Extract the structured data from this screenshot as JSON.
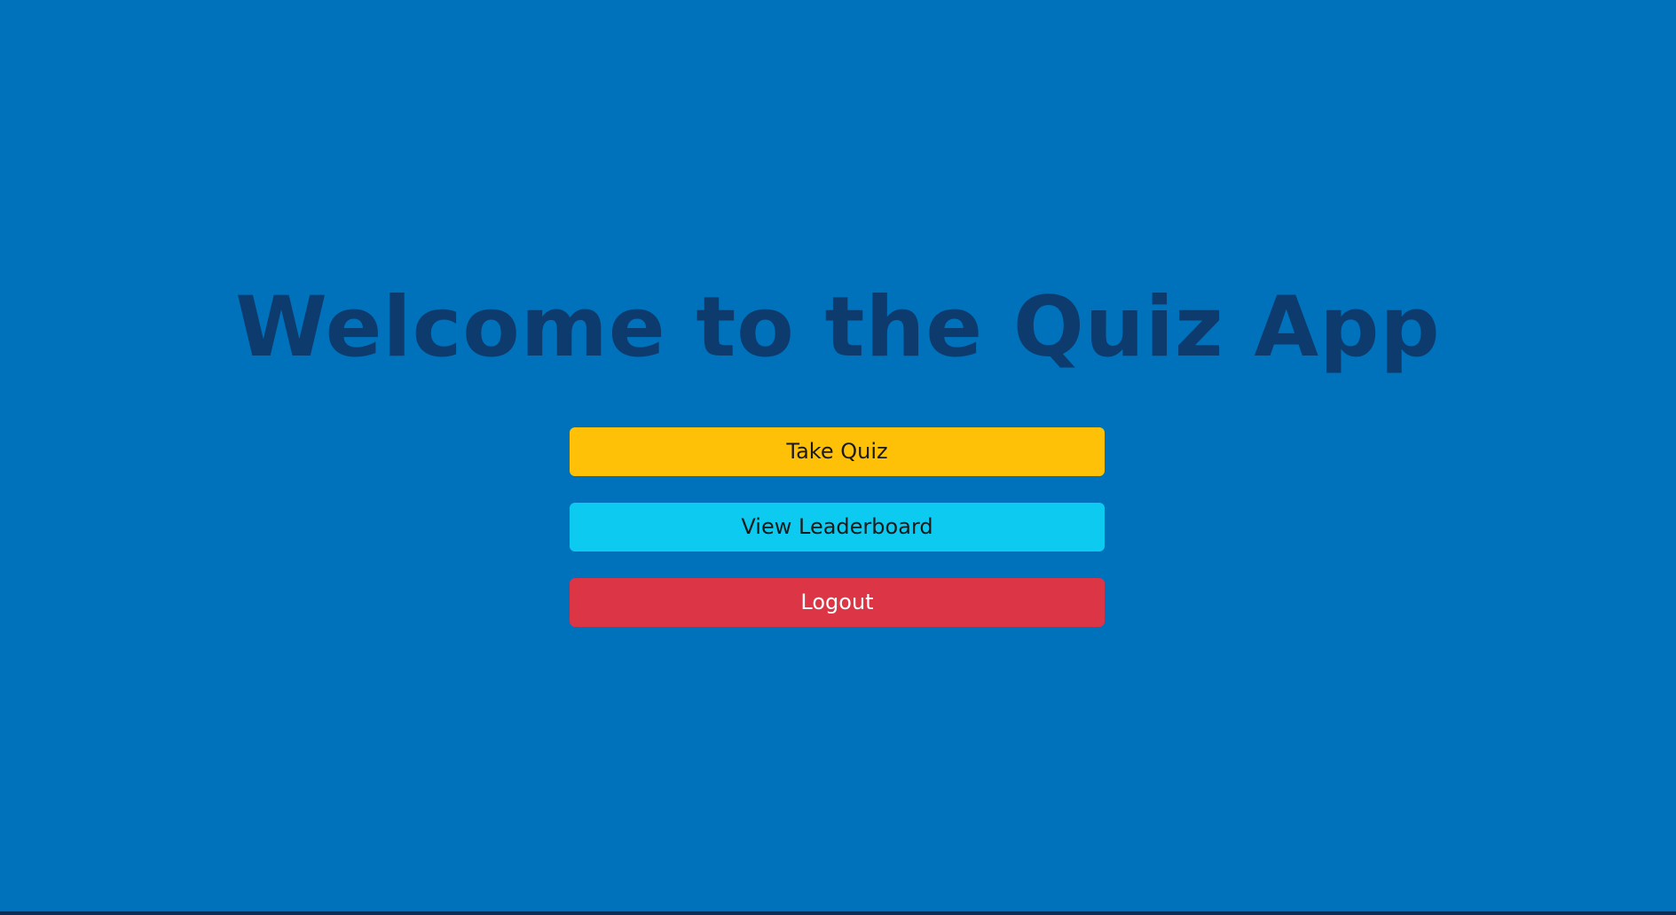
{
  "header": {
    "title": "Welcome to the Quiz App"
  },
  "menu": {
    "take_quiz_label": "Take Quiz",
    "leaderboard_label": "View Leaderboard",
    "logout_label": "Logout"
  },
  "colors": {
    "background": "#0072bc",
    "title": "#0d3b6e",
    "take_quiz": "#ffc107",
    "leaderboard": "#0dcaf0",
    "logout": "#dc3545"
  }
}
